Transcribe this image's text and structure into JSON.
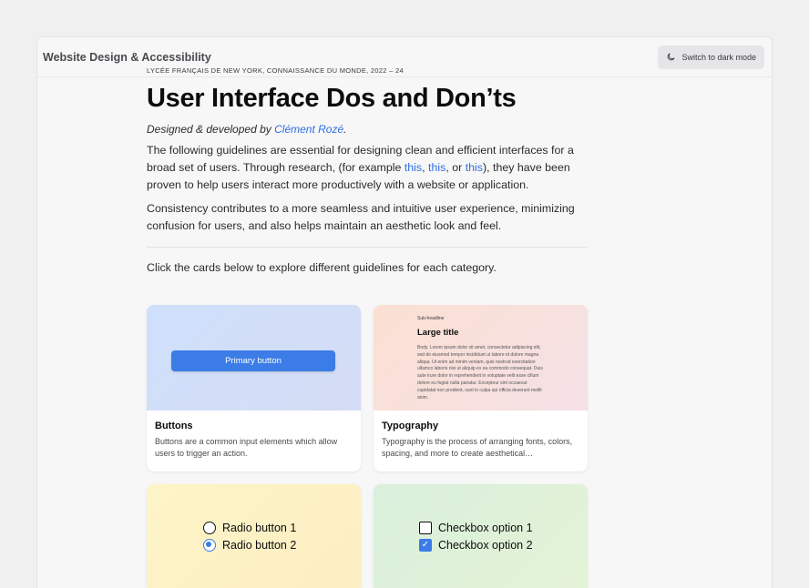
{
  "header": {
    "title": "Website Design & Accessibility",
    "dark_mode_label": "Switch to dark mode",
    "dark_mode_icon": "moon-icon"
  },
  "intro": {
    "eyebrow": "LYCÉE FRANÇAIS DE NEW YORK, CONNAISSANCE DU MONDE, 2022 – 24",
    "title": "User Interface Dos and Don’ts",
    "byline_prefix": "Designed & developed by ",
    "byline_author": "Clément Rozé",
    "byline_suffix": ".",
    "p1_a": "The following guidelines are essential for designing clean and efficient interfaces for a broad set of users. Through research, (for example ",
    "p1_link1": "this",
    "p1_sep1": ", ",
    "p1_link2": "this",
    "p1_sep2": ", or ",
    "p1_link3": "this",
    "p1_b": "), they have been proven to help users interact more productively with a website or application.",
    "p2": "Consistency contributes to a more seamless and intuitive user experience, minimizing confusion for users, and also helps maintain an aesthetic look and feel.",
    "explore": "Click the cards below to explore different guidelines for each category."
  },
  "cards": [
    {
      "title": "Buttons",
      "description": "Buttons are a common input elements which allow users to trigger an action.",
      "preview_button": "Primary button"
    },
    {
      "title": "Typography",
      "description": "Typography is the process of arranging fonts, colors, spacing, and more to create aesthetical…",
      "preview_sub": "Sub-headline",
      "preview_large": "Large title",
      "preview_body": "Body. Lorem ipsum dolor sit amet, consectetur adipiscing elit, sed do eiusmod tempor incididunt ut labore et dolore magna aliqua. Ut enim ad minim veniam, quis nostrud exercitation ullamco laboris nisi ut aliquip ex ea commodo consequat. Duis aute irure dolor in reprehenderit in voluptate velit esse cillum dolore eu fugiat nulla pariatur. Excepteur sint occaecat cupidatat non proident, sunt in culpa qui officia deserunt mollit anim."
    },
    {
      "radio_1": "Radio button 1",
      "radio_2": "Radio button 2"
    },
    {
      "check_1": "Checkbox option 1",
      "check_2": "Checkbox option 2"
    }
  ],
  "colors": {
    "accent": "#3b7ce6",
    "link": "#2f6fe0",
    "page_bg": "#f0f0f0"
  }
}
